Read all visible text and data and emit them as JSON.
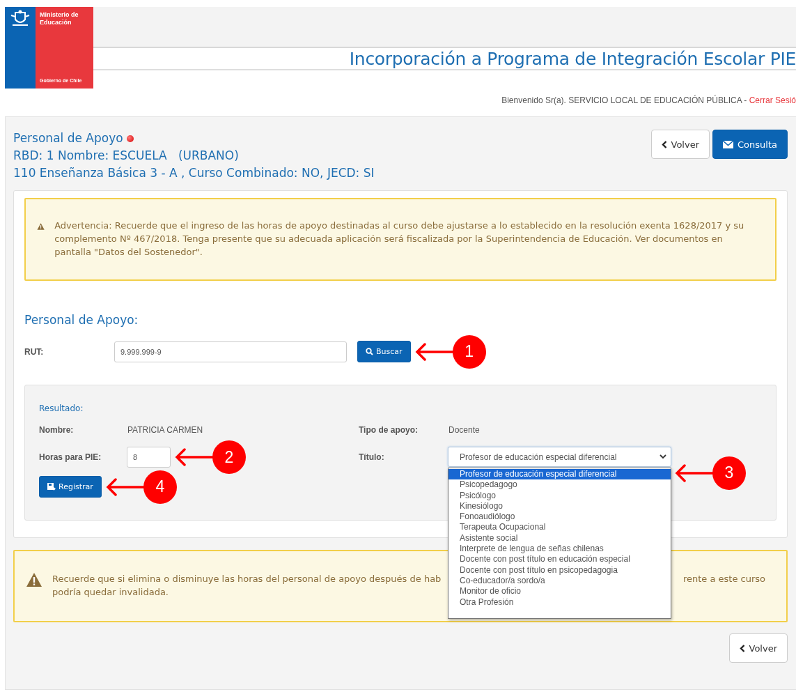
{
  "header": {
    "logo_lines": [
      "Ministerio de",
      "Educación"
    ],
    "logo_footer": "Gobierno de Chile",
    "title": "Incorporación a Programa de Integración Escolar PIE",
    "welcome": "Bienvenido Sr(a). SERVICIO LOCAL DE EDUCACIÓN PÚBLICA - ",
    "logout": "Cerrar Sesió"
  },
  "page": {
    "title": "Personal de Apoyo",
    "subtitle_1": "RBD: 1 Nombre: ESCUELA   (URBANO)",
    "subtitle_2": "110 Enseñanza Básica 3 - A , Curso Combinado: NO, JECD: SI",
    "buttons": [
      {
        "label": "Volver",
        "kind": "back"
      },
      {
        "label": "Consulta",
        "kind": "mail"
      }
    ]
  },
  "warning": "Advertencia: Recuerde que el ingreso de las horas de apoyo destinadas al curso debe ajustarse a lo establecido en la resolución exenta 1628/2017 y su complemento Nº 467/2018. Tenga presente que su adecuada aplicación será fiscalizada por la Superintendencia de Educación. Ver documentos en pantalla \"Datos del Sostenedor\".",
  "form": {
    "heading": "Personal de Apoyo:",
    "rut_label": "RUT:",
    "rut_value": "9.999.999-9",
    "search_button": "Buscar",
    "search_callout": "1"
  },
  "result": {
    "heading": "Resultado:",
    "name_label": "Nombre:",
    "name_value": "PATRICIA CARMEN",
    "type_label": "Tipo de apoyo:",
    "type_value": "Docente",
    "hours_label": "Horas para PIE:",
    "hours_value": "8",
    "hours_callout": "2",
    "title_label": "Título:",
    "title_value": "Profesor de educación especial diferencial",
    "title_callout": "3",
    "title_options": [
      {
        "label": "Profesor de educación especial diferencial",
        "selected": true
      },
      {
        "label": "Psicopedagogo",
        "selected": false
      },
      {
        "label": "Psicólogo",
        "selected": false
      },
      {
        "label": "Kinesiólogo",
        "selected": false
      },
      {
        "label": "Fonoaudiólogo",
        "selected": false
      },
      {
        "label": "Terapeuta Ocupacional",
        "selected": false
      },
      {
        "label": "Asistente social",
        "selected": false
      },
      {
        "label": "Interprete de lengua de señas chilenas",
        "selected": false
      },
      {
        "label": "Docente con post título en educación especial",
        "selected": false
      },
      {
        "label": "Docente con post título en psicopedagogia",
        "selected": false
      },
      {
        "label": "Co-educador/a sordo/a",
        "selected": false
      },
      {
        "label": "Monitor de oficio",
        "selected": false
      },
      {
        "label": "Otra Profesión",
        "selected": false
      }
    ],
    "register_button": "Registrar",
    "register_callout": "4"
  },
  "notice": {
    "line_1_parts": [
      "Recuerde que si elimina o disminuye las horas del personal de apoyo después de hab",
      "rente a este curso"
    ],
    "line_2": "podría quedar invalidada."
  },
  "footer_button": {
    "label": "Volver",
    "kind": "back"
  }
}
